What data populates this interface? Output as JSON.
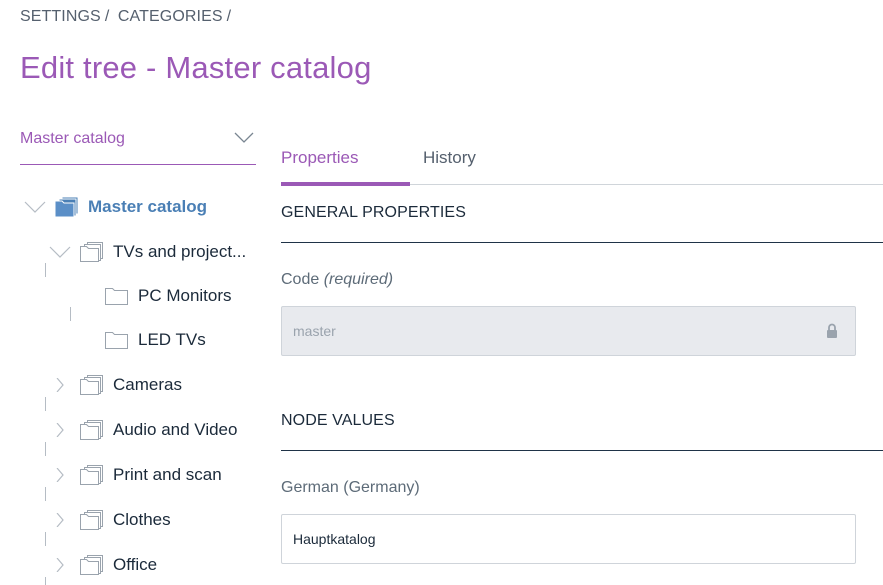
{
  "breadcrumb": [
    "SETTINGS",
    "/",
    "CATEGORIES",
    "/"
  ],
  "page_title": "Edit tree - Master catalog",
  "tree_selector": {
    "value": "Master catalog",
    "icon": "chevron-down-icon"
  },
  "tree": {
    "root": {
      "label": "Master catalog",
      "expanded": true,
      "icon": "folder-stack-icon"
    },
    "children": [
      {
        "label": "TVs and project...",
        "expanded": true,
        "icon": "folder-stack-icon",
        "children": [
          {
            "label": "PC Monitors",
            "icon": "folder-icon"
          },
          {
            "label": "LED TVs",
            "icon": "folder-icon"
          }
        ]
      },
      {
        "label": "Cameras",
        "expanded": false,
        "icon": "folder-stack-icon"
      },
      {
        "label": "Audio and Video",
        "expanded": false,
        "icon": "folder-stack-icon"
      },
      {
        "label": "Print and scan",
        "expanded": false,
        "icon": "folder-stack-icon"
      },
      {
        "label": "Clothes",
        "expanded": false,
        "icon": "folder-stack-icon"
      },
      {
        "label": "Office",
        "expanded": false,
        "icon": "folder-stack-icon"
      }
    ]
  },
  "tabs": [
    {
      "label": "Properties",
      "active": true
    },
    {
      "label": "History",
      "active": false
    }
  ],
  "general_properties": {
    "title": "GENERAL PROPERTIES",
    "code_label": "Code",
    "code_required": "(required)",
    "code_value": "master",
    "code_locked": true
  },
  "node_values": {
    "title": "NODE VALUES",
    "german_label": "German (Germany)",
    "german_value": "Hauptkatalog"
  },
  "colors": {
    "accent": "#9b59b6",
    "root_node": "#4a7fb5",
    "text": "#1b2a3a",
    "muted": "#5d6b78",
    "disabled_bg": "#e8eaee"
  }
}
